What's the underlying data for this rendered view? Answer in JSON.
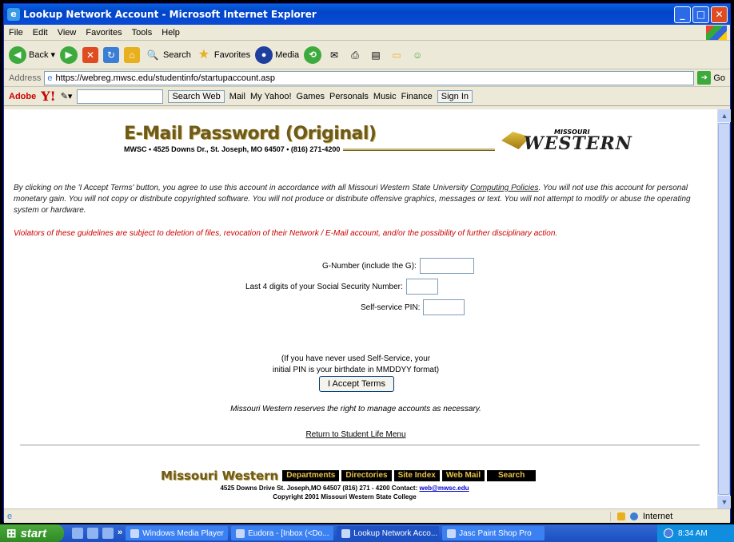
{
  "window": {
    "title": "Lookup Network Account - Microsoft Internet Explorer",
    "btn_min": "_",
    "btn_max": "□",
    "btn_close": "✕"
  },
  "menubar": [
    "File",
    "Edit",
    "View",
    "Favorites",
    "Tools",
    "Help"
  ],
  "toolbar": {
    "back": "Back",
    "search": "Search",
    "favorites": "Favorites",
    "media": "Media"
  },
  "address": {
    "label": "Address",
    "url": "https://webreg.mwsc.edu/studentinfo/startupaccount.asp",
    "go": "Go"
  },
  "ytoolbar": {
    "adobe": "Adobe",
    "yahoo": "Y!",
    "search_web": "Search Web",
    "mail": "Mail",
    "my_yahoo": "My Yahoo!",
    "games": "Games",
    "personals": "Personals",
    "music": "Music",
    "finance": "Finance",
    "sign_in": "Sign In"
  },
  "page": {
    "heading": "E-Mail Password (Original)",
    "address_line": "MWSC • 4525 Downs Dr., St. Joseph, MO 64507 • (816) 271-4200",
    "logo_small": "MISSOURI",
    "logo_big": "WESTERN",
    "terms_before": "By clicking on the 'I Accept Terms' button, you agree to use this account in accordance with all Missouri Western State University ",
    "terms_link": "Computing Policies",
    "terms_after": ". You will not use this account for personal monetary gain. You will not copy or distribute copyrighted software. You will not produce or distribute offensive graphics, messages or text. You will not attempt to modify or abuse the operating system or hardware.",
    "violators": "Violators of these guidelines are subject to deletion of files, revocation of their Network / E-Mail account, and/or the possibility of further disciplinary action.",
    "gnumber_label": "G-Number (include the G):",
    "ssn_label": "Last 4 digits of your Social Security Number:",
    "pin_label": "Self-service PIN:",
    "note_line1": "(If you have never used Self-Service, your",
    "note_line2": "initial PIN is your birthdate in MMDDYY format)",
    "accept_button": "I Accept Terms",
    "reserve": "Missouri Western reserves the right to manage accounts as necessary.",
    "return_link": "Return to Student Life Menu"
  },
  "footer": {
    "logo": "Missouri Western",
    "links": [
      "Departments",
      "Directories",
      "Site Index",
      "Web Mail",
      "Search"
    ],
    "contact_prefix": "4525 Downs Drive  St. Joseph,MO 64507  (816) 271 - 4200   Contact: ",
    "contact_email": "web@mwsc.edu",
    "copyright": "Copyright 2001 Missouri Western State College"
  },
  "status": {
    "zone": "Internet"
  },
  "taskbar": {
    "start": "start",
    "tasks": [
      "Windows Media Player",
      "Eudora - [Inbox (<Do...",
      "Lookup Network Acco...",
      "Jasc Paint Shop Pro"
    ],
    "clock": "8:34 AM"
  }
}
